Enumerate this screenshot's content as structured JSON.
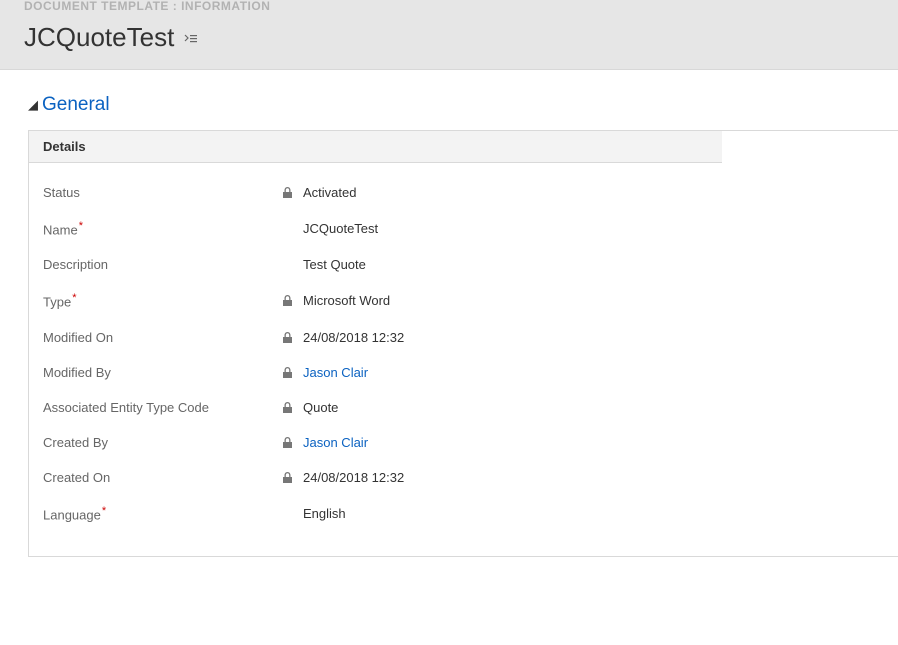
{
  "header": {
    "breadcrumb": "DOCUMENT TEMPLATE : INFORMATION",
    "title": "JCQuoteTest"
  },
  "section": {
    "title": "General",
    "expanded": true
  },
  "details": {
    "header": "Details",
    "fields": {
      "status": {
        "label": "Status",
        "value": "Activated",
        "locked": true,
        "required": false,
        "link": false
      },
      "name": {
        "label": "Name",
        "value": "JCQuoteTest",
        "locked": false,
        "required": true,
        "link": false
      },
      "description": {
        "label": "Description",
        "value": "Test Quote",
        "locked": false,
        "required": false,
        "link": false
      },
      "type": {
        "label": "Type",
        "value": "Microsoft Word",
        "locked": true,
        "required": true,
        "link": false
      },
      "modified_on": {
        "label": "Modified On",
        "value": "24/08/2018  12:32",
        "locked": true,
        "required": false,
        "link": false
      },
      "modified_by": {
        "label": "Modified By",
        "value": "Jason Clair",
        "locked": true,
        "required": false,
        "link": true
      },
      "associated_entity": {
        "label": "Associated Entity Type Code",
        "value": "Quote",
        "locked": true,
        "required": false,
        "link": false
      },
      "created_by": {
        "label": "Created By",
        "value": "Jason Clair",
        "locked": true,
        "required": false,
        "link": true
      },
      "created_on": {
        "label": "Created On",
        "value": "24/08/2018  12:32",
        "locked": true,
        "required": false,
        "link": false
      },
      "language": {
        "label": "Language",
        "value": "English",
        "locked": false,
        "required": true,
        "link": false
      }
    }
  }
}
